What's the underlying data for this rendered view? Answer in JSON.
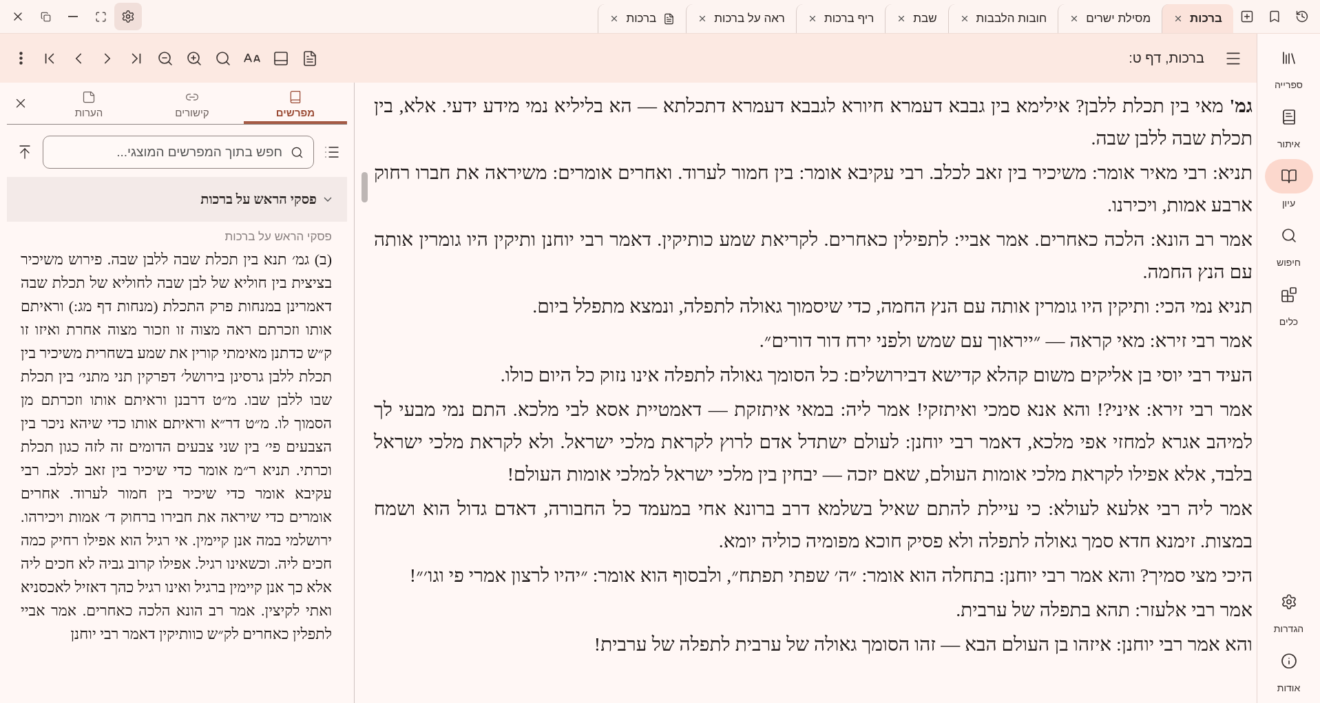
{
  "tab_bar": {
    "settings_button": {
      "active": true
    },
    "tabs": [
      {
        "label": "ברכות",
        "selected": true,
        "kind": "book"
      },
      {
        "label": "מסילת ישרים",
        "selected": false,
        "kind": "book"
      },
      {
        "label": "חובות הלבבות",
        "selected": false,
        "kind": "book"
      },
      {
        "label": "שבת",
        "selected": false,
        "kind": "book"
      },
      {
        "label": "ריף ברכות",
        "selected": false,
        "kind": "book"
      },
      {
        "label": "ראה על ברכות",
        "selected": false,
        "kind": "book"
      },
      {
        "label": "ברכות",
        "selected": false,
        "kind": "pdf"
      }
    ]
  },
  "toolbar": {
    "title": "ברכות, דף ט:"
  },
  "sidebar": {
    "items": [
      {
        "label": "ספרייה",
        "kind": "library",
        "selected": false
      },
      {
        "label": "איתור",
        "kind": "locate",
        "selected": false
      },
      {
        "label": "עיון",
        "kind": "read",
        "selected": true
      },
      {
        "label": "חיפוש",
        "kind": "search",
        "selected": false
      },
      {
        "label": "כלים",
        "kind": "tools",
        "selected": false
      }
    ],
    "bottom_items": [
      {
        "label": "הגדרות",
        "kind": "settings",
        "selected": false
      },
      {
        "label": "אודות",
        "kind": "about",
        "selected": false
      }
    ]
  },
  "commentary_panel": {
    "tabs": [
      {
        "label": "מפרשים",
        "kind": "commentaries",
        "selected": true
      },
      {
        "label": "קישורים",
        "kind": "links",
        "selected": false
      },
      {
        "label": "הערות",
        "kind": "notes",
        "selected": false
      }
    ],
    "search": {
      "placeholder": "חפש בתוך המפרשים המוצגי..."
    },
    "groups": [
      {
        "title": "פסקי הראש על ברכות",
        "expanded": true,
        "source": "פסקי הראש על ברכות",
        "text": "(ב) גמ׳ תנא בין תכלת שבה ללבן שבה. פירוש משיכיר בציצית בין חוליא של לבן שבה לחוליא של תכלת שבה דאמרינן במנחות פרק התכלת (מנחות דף מג:) וראיתם אותו וזכרתם ראה מצוה זו וזכור מצוה אחרת ואיזו זו ק״ש כדתנן מאימתי קורין את שמע בשחרית משיכיר בין תכלת ללבן גרסינן בירושל׳ דפרקין תני מתני׳ בין תכלת שבו ללבן שבו. מ״ט דרבנן וראיתם אותו וזכרתם מן הסמוך לו. מ״ט דר״א וראיתם אותו כדי שיהא ניכר בין הצבעים פי׳ בין שני צבעים הדומים זה לזה כגון תכלת וכרתי. תניא ר״מ אומר כדי שיכיר בין זאב לכלב. רבי עקיבא אומר כדי שיכיר בין חמור לערוד. אחרים אומרים כדי שיראה את חבירו ברחוק ד׳ אמות ויכירהו. ירושלמי במה אנן קיימין. אי רגיל הוא אפילו רחיק כמה חכים ליה. וכשאינו רגיל. אפילו קרוב גביה לא חכים ליה אלא כך אנן קיימין ברגיל ואינו רגיל כהך דאזיל לאכסניא ואתי לקיצין. אמר רב הונא הלכה כאחרים. אמר אביי לתפלין כאחרים לק״ש כוותיקין דאמר רבי יוחנן"
      }
    ]
  },
  "main_text": {
    "paragraphs": [
      "**גמ'** מאי בין תכלת ללבן? אילימא בין גבבא דעמרא חיורא לגבבא דעמרא דתכלתא — הא בליליא נמי מידע ידעי. אלא, בין תכלת שבה ללבן שבה.",
      "תניא: רבי מאיר אומר: משיכיר בין זאב לכלב. רבי עקיבא אומר: בין חמור לערוד. ואחרים אומרים: משיראה את חברו רחוק ארבע אמות, ויכירנו.",
      "אמר רב הונא: הלכה כאחרים. אמר אביי: לתפילין כאחרים. לקריאת שמע כותיקין. דאמר רבי יוחנן ותיקין היו גומרין אותה עם הנץ החמה.",
      "תניא נמי הכי: ותיקין היו גומרין אותה עם הנץ החמה, כדי שיסמוך גאולה לתפלה, ונמצא מתפלל ביום.",
      "אמר רבי זירא: מאי קראה — ״ייראוך עם שמש ולפני ירח דור דורים״.",
      "העיד רבי יוסי בן אליקים משום קהלא קדישא דבירושלים: כל הסומך גאולה לתפלה אינו נזוק כל היום כולו.",
      "אמר רבי זירא: איני?! והא אנא סמכי ואיתזקי! אמר ליה: במאי איתזקת — דאמטיית אסא לבי מלכא. התם נמי מבעי לך למיהב אגרא למחזי אפי מלכא, דאמר רבי יוחנן: לעולם ישתדל אדם לרוץ לקראת מלכי ישראל. ולא לקראת מלכי ישראל בלבד, אלא אפילו לקראת מלכי אומות העולם, שאם יזכה — יבחין בין מלכי ישראל למלכי אומות העולם!",
      "אמר ליה רבי אלעא לעולא: כי עיילת להתם שאיל בשלמא דרב ברונא אחי במעמד כל החבורה, דאדם גדול הוא ושמח במצות. זימנא חדא סמך גאולה לתפלה ולא פסיק חוכא מפומיה כוליה יומא.",
      "היכי מצי סמיך? והא אמר רבי יוחנן: בתחלה הוא אומר: ״ה׳ שפתי תפתח״, ולבסוף הוא אומר: ״יהיו לרצון אמרי פי וגו׳״!",
      "אמר רבי אלעזר: תהא בתפלה של ערבית.",
      "והא אמר רבי יוחנן: איזהו בן העולם הבא — זהו הסומך גאולה של ערבית לתפלה של ערבית!"
    ]
  }
}
